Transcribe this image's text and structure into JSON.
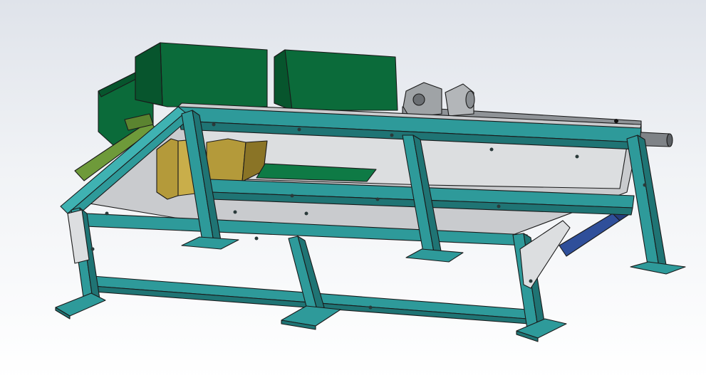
{
  "scene": {
    "background_top": "#dfe3ea",
    "background_bottom": "#ffffff",
    "colors": {
      "frame": "#2e9a9a",
      "frame_dark": "#1f7474",
      "frame_light": "#3fb2b2",
      "plate": "#c9cbce",
      "plate_light": "#dcdee0",
      "motor_box": "#0b6b3a",
      "motor_box_dark": "#07552d",
      "roller": "#b49a3a",
      "roller_dark": "#8a7426",
      "green_plate": "#0e7a45",
      "olive_bracket": "#6e9a3a",
      "blue_block": "#2f4f9a",
      "shaft": "#7f8387"
    }
  }
}
